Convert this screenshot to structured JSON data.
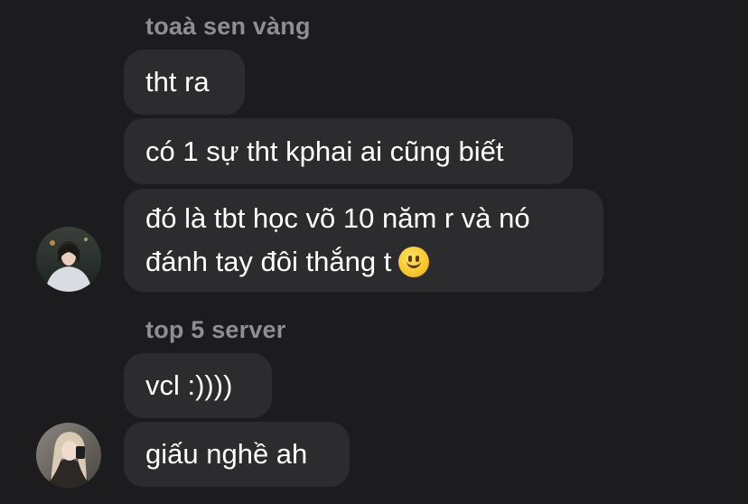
{
  "groups": [
    {
      "sender": "toaà sen vàng",
      "messages": [
        "tht ra",
        "có 1 sự tht kphai ai cũng biết",
        [
          "đó là tbt học võ 10 năm r và nó",
          "đánh tay đôi thắng t"
        ]
      ],
      "last_message_emoji": "slightly-smiling-face-icon"
    },
    {
      "sender": "top 5 server",
      "messages": [
        "vcl :))))",
        "giấu nghề ah"
      ]
    }
  ]
}
